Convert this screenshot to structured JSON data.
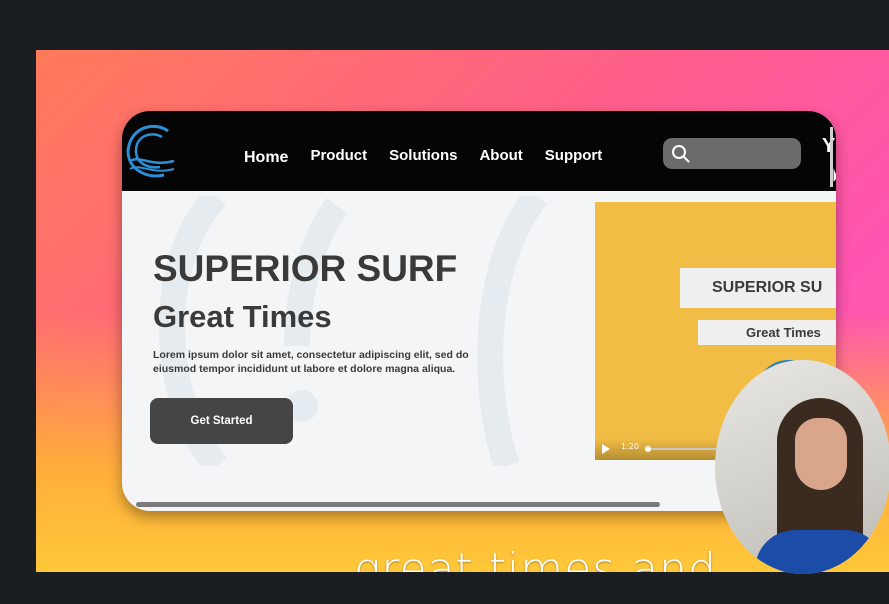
{
  "mockup": {
    "nav": {
      "items": [
        "Home",
        "Product",
        "Solutions",
        "About",
        "Support"
      ]
    },
    "hero": {
      "title": "SUPERIOR SURF",
      "subtitle": "Great Times",
      "body": "Lorem ipsum dolor sit amet, consectetur adipiscing elit, sed do eiusmod tempor incididunt ut labore et dolore magna aliqua.",
      "cta_label": "Get Started"
    },
    "video": {
      "title": "SUPERIOR SU",
      "subtitle": "Great Times",
      "time": "1:20",
      "progress_fraction": 0.0
    },
    "partial_user_glyph": "Y"
  },
  "caption": "great times and",
  "colors": {
    "navbar": "#050505",
    "video_bg": "#f2bd45",
    "cta": "#454545",
    "gradient_top": "#ff5fa8",
    "gradient_bottom": "#ffc83a"
  }
}
